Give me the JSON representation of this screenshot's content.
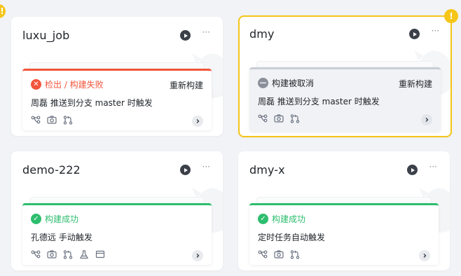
{
  "colors": {
    "failure": "#f2553b",
    "success": "#2dbd6e",
    "canceled": "#8a8f99",
    "warning": "#f5c518"
  },
  "cards": [
    {
      "title": "luxu_job",
      "more": "···",
      "build": {
        "status": "检出 / 构建失败",
        "status_icon": "close-icon",
        "rebuild": "重新构建",
        "trigger": "周磊 推送到分支 master 时触发",
        "icons": [
          "pipeline-icon",
          "camera-icon",
          "merge-request-icon"
        ]
      }
    },
    {
      "title": "dmy",
      "more": "···",
      "warning_badge": "!",
      "build": {
        "status": "构建被取消",
        "status_icon": "minus-icon",
        "rebuild": "重新构建",
        "trigger": "周磊 推送到分支 master 时触发",
        "icons": [
          "pipeline-icon",
          "camera-icon",
          "merge-request-icon"
        ]
      }
    },
    {
      "title": "demo-222",
      "more": "···",
      "build": {
        "status": "构建成功",
        "status_icon": "check-icon",
        "trigger": "孔德远 手动触发",
        "icons": [
          "pipeline-icon",
          "camera-icon",
          "merge-request-icon",
          "flask-icon",
          "artifact-icon"
        ]
      }
    },
    {
      "title": "dmy-x",
      "more": "···",
      "build": {
        "status": "构建成功",
        "status_icon": "check-icon",
        "trigger": "定时任务自动触发",
        "icons": [
          "pipeline-icon",
          "camera-icon",
          "merge-request-icon"
        ]
      }
    }
  ],
  "edge_badge": "!"
}
